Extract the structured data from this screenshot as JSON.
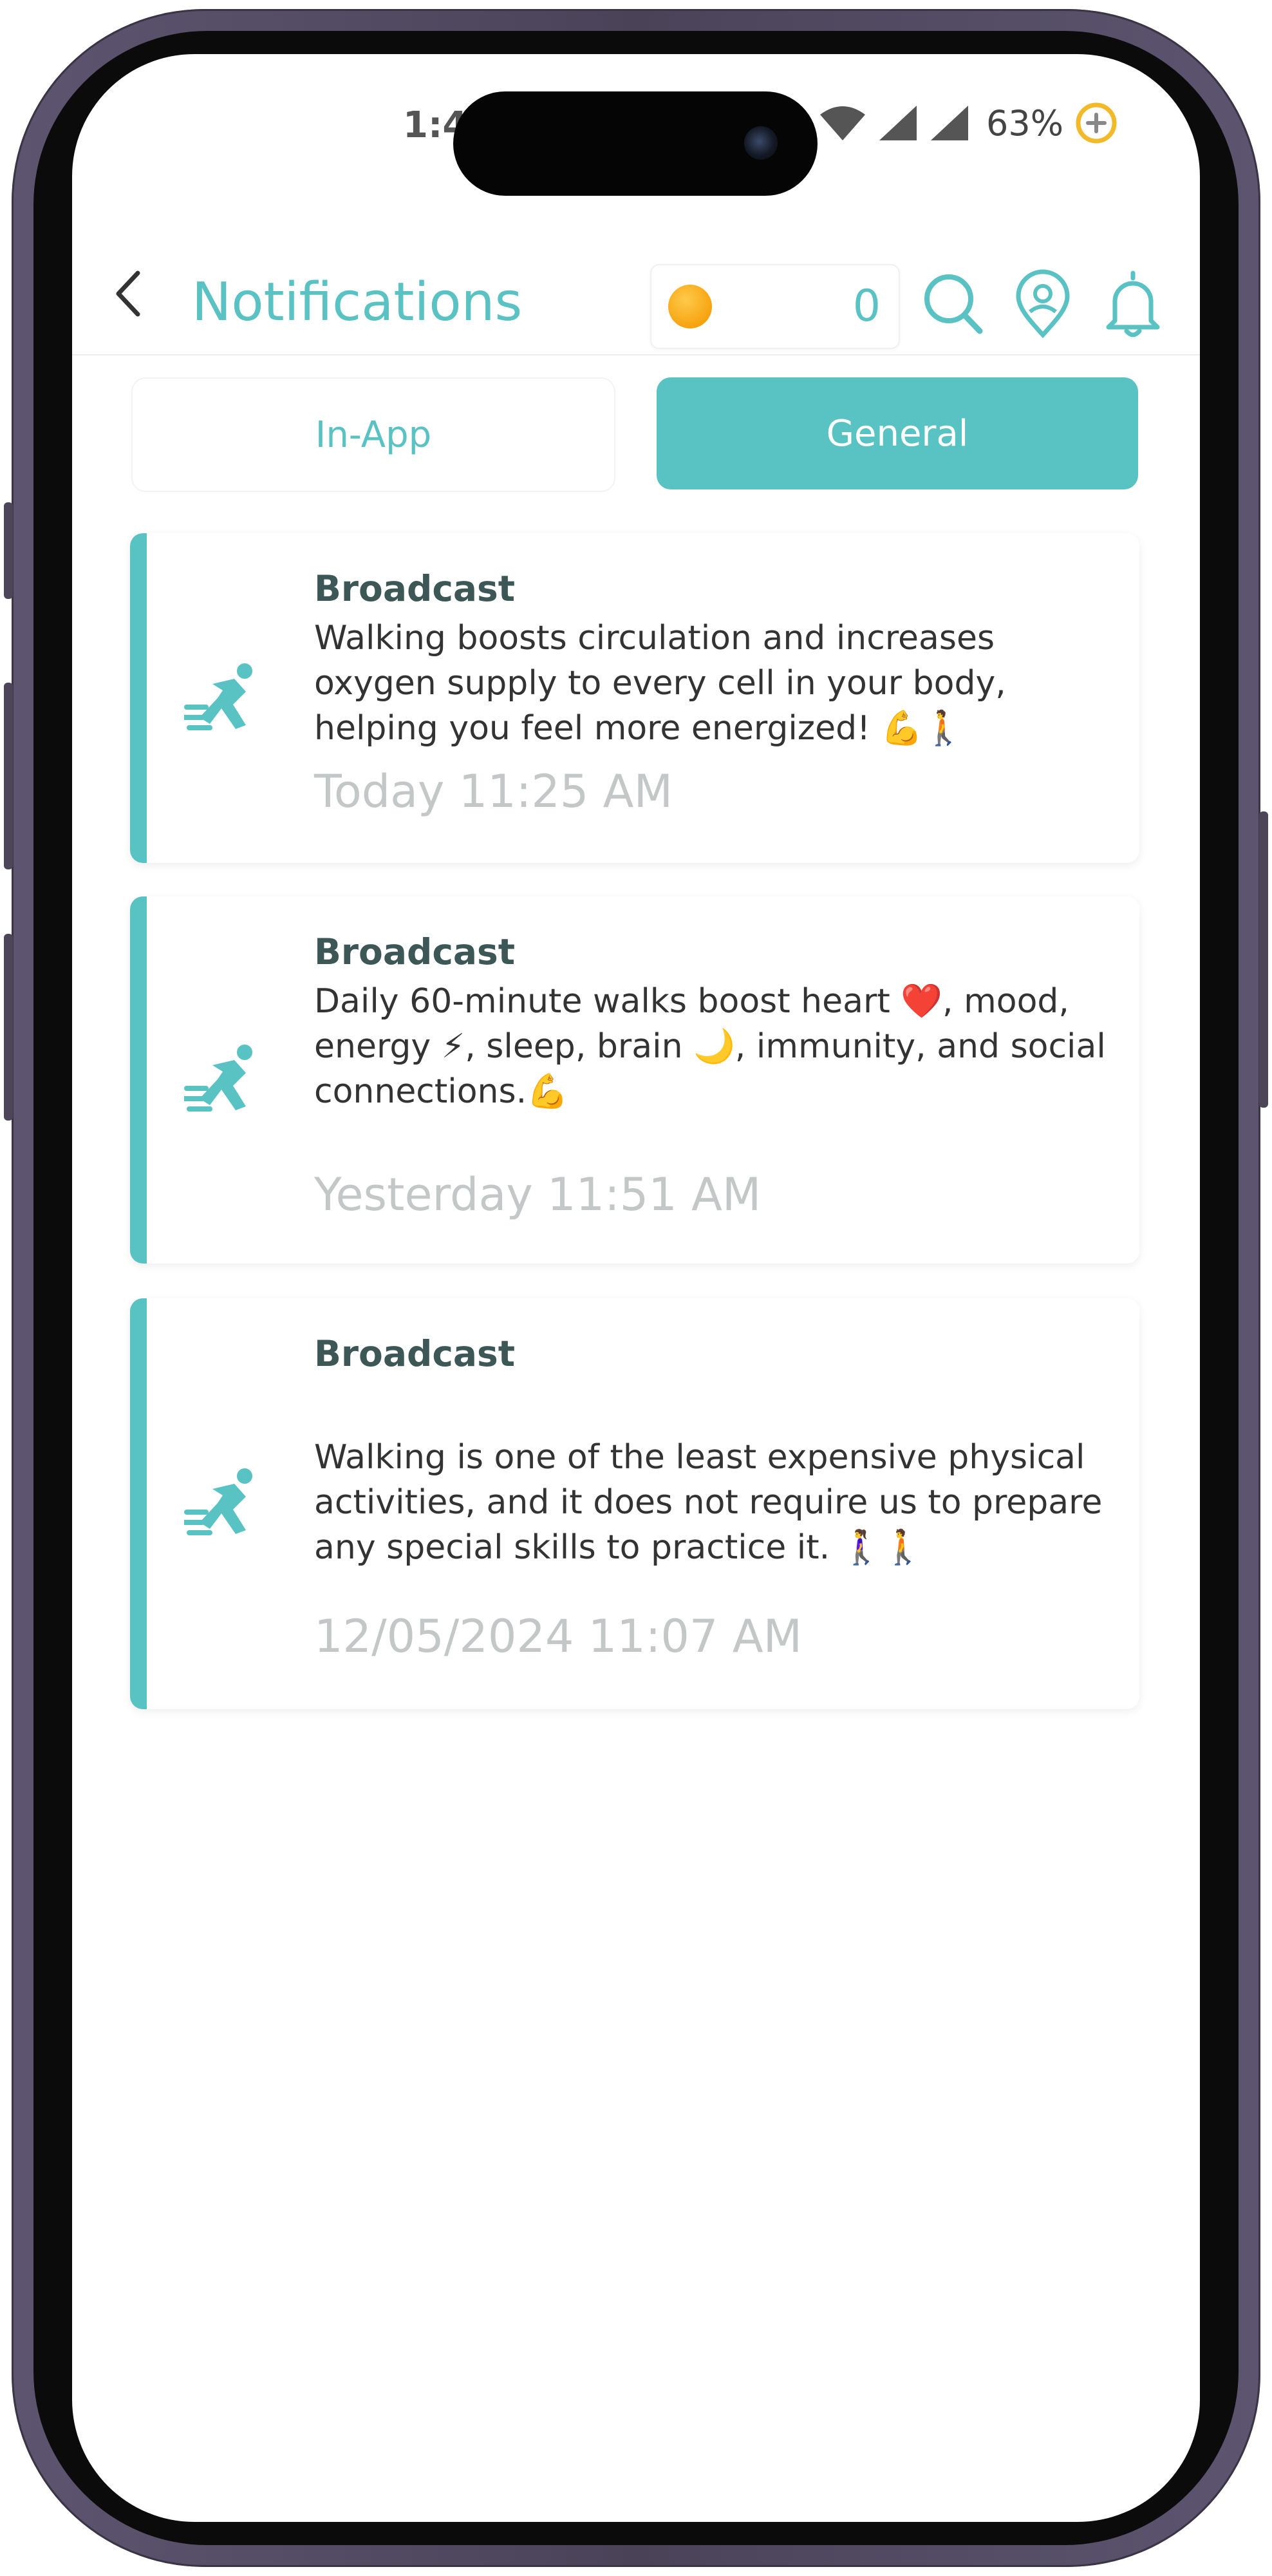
{
  "status_bar": {
    "time": "1:4",
    "battery": "63%"
  },
  "header": {
    "title": "Notifications",
    "coin_balance": "0"
  },
  "tabs": [
    {
      "label": "In-App",
      "active": false
    },
    {
      "label": "General",
      "active": true
    }
  ],
  "notifications": [
    {
      "title": "Broadcast",
      "body": "Walking boosts circulation and increases oxygen supply to every cell in your body, helping you feel more energized! 💪🚶",
      "time": "Today 11:25 AM"
    },
    {
      "title": "Broadcast",
      "body": "Daily 60-minute walks boost heart ❤️, mood, energy ⚡, sleep, brain 🌙, immunity, and social connections.💪",
      "time": "Yesterday 11:51 AM"
    },
    {
      "title": "Broadcast",
      "body": "Walking is one of the least expensive physical activities, and it does not require us to prepare any special skills to practice it. 🚶‍♀️🚶",
      "time": "12/05/2024 11:07 AM"
    }
  ],
  "colors": {
    "accent": "#59c2c3",
    "title_dark": "#3d5757",
    "timestamp": "#c3c7c8",
    "coin": "#f6a410"
  },
  "icons": [
    "back-chevron-icon",
    "coin-icon",
    "search-icon",
    "location-pin-icon",
    "bell-icon",
    "runner-icon"
  ]
}
